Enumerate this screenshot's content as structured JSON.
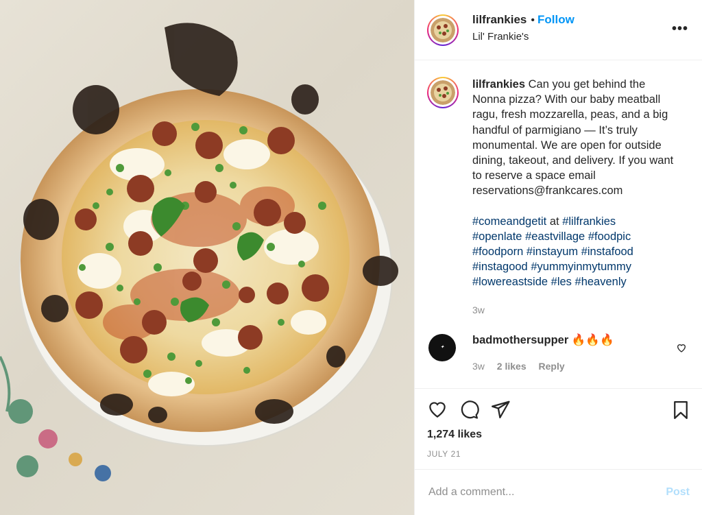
{
  "post": {
    "photo_alt": "",
    "header": {
      "username": "lilfrankies",
      "follow_label": "Follow",
      "location": "Lil' Frankie's",
      "more_label": "•••"
    },
    "caption": {
      "username": "lilfrankies",
      "text": "Can you get behind the Nonna pizza? With our baby meatball ragu, fresh mozzarella, peas, and a big handful of parmigiano — It’s truly monumental. We are open for outside dining, takeout, and delivery. If you want to reserve a space email reservations@frankcares.com",
      "hashtags_line1": [
        "#comeandgetit",
        "at",
        "#lilfrankies"
      ],
      "hashtags": [
        "#openlate",
        "#eastvillage",
        "#foodpic",
        "#foodporn",
        "#instayum",
        "#instafood",
        "#instagood",
        "#yummyinmytummy",
        "#lowereastside",
        "#les",
        "#heavenly"
      ],
      "time": "3w"
    },
    "comments": [
      {
        "username": "badmothersupper",
        "text": "🔥🔥🔥",
        "time": "3w",
        "likes": "2 likes",
        "reply_label": "Reply"
      }
    ],
    "likes": "1,274 likes",
    "date": "JULY 21",
    "add_comment_placeholder": "Add a comment...",
    "post_button": "Post"
  },
  "icons": [
    "heart-icon",
    "comment-icon",
    "share-icon",
    "bookmark-icon",
    "more-icon"
  ],
  "colors": {
    "link": "#0095f6",
    "hashtag": "#00376b",
    "muted": "#8e8e8e",
    "post_disabled": "#b2dffc"
  }
}
